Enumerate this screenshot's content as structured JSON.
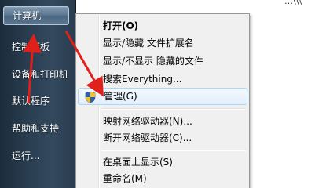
{
  "start_menu": {
    "items": [
      {
        "label": "计算机",
        "selected": true
      },
      {
        "label": "控制面板",
        "selected": false
      },
      {
        "label": "设备和打印机",
        "selected": false
      },
      {
        "label": "默认程序",
        "selected": false
      },
      {
        "label": "帮助和支持",
        "selected": false
      },
      {
        "label": "运行...",
        "selected": false
      }
    ]
  },
  "context_menu": {
    "items": [
      {
        "label": "打开(O)",
        "bold": true
      },
      {
        "label": "显示/隐藏 文件扩展名"
      },
      {
        "label": "显示/不显示 隐藏的文件"
      },
      {
        "label": "搜索Everything..."
      },
      {
        "label": "管理(G)",
        "icon": "uac-shield-icon",
        "highlighted": true
      },
      {
        "label": "映射网络驱动器(N)..."
      },
      {
        "label": "断开网络驱动器(C)..."
      },
      {
        "label": "在桌面上显示(S)"
      },
      {
        "label": "重命名(M)"
      }
    ]
  },
  "corner_text": "…\\\\\\",
  "colors": {
    "annotation_arrow": "#e0201b",
    "menu_background": "#f0f0f0",
    "highlight_border": "#a8d8f7",
    "start_pane": "#2a3f52"
  }
}
